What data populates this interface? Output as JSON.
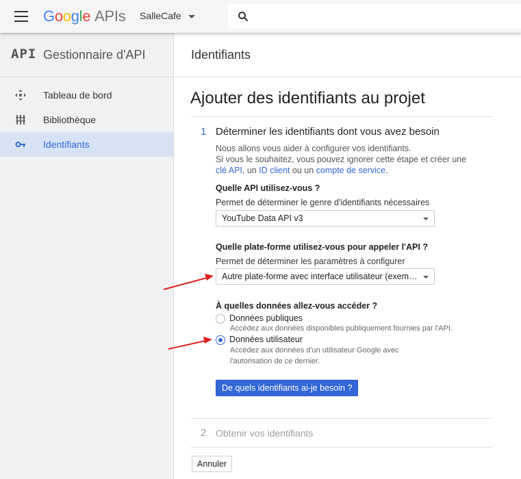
{
  "topbar": {
    "logo_letters": [
      "G",
      "o",
      "o",
      "g",
      "l",
      "e"
    ],
    "logo_suffix": "APIs",
    "project": "SalleCafe",
    "search_value": ""
  },
  "sidebar": {
    "title": "Gestionnaire d'API",
    "api_mark": "API",
    "items": [
      {
        "label": "Tableau de bord",
        "icon": "dashboard-icon"
      },
      {
        "label": "Bibliothèque",
        "icon": "library-icon"
      },
      {
        "label": "Identifiants",
        "icon": "key-icon",
        "active": true
      }
    ]
  },
  "main": {
    "header": "Identifiants",
    "title": "Ajouter des identifiants au projet",
    "step1": {
      "number": "1",
      "title": "Déterminer les identifiants dont vous avez besoin",
      "intro_line1": "Nous allons vous aider à configurer vos identifiants.",
      "intro_line2": "Si vous le souhaitez, vous pouvez ignorer cette étape et créer une",
      "link_api_key": "clé API",
      "sep1": ", un ",
      "link_client_id": "ID client",
      "sep2": " ou un ",
      "link_service_account": "compte de service",
      "end": ".",
      "q1": {
        "label": "Quelle API utilisez-vous ?",
        "hint": "Permet de déterminer le genre d'identifiants nécessaires",
        "value": "YouTube Data API v3"
      },
      "q2": {
        "label": "Quelle plate-forme utilisez-vous pour appeler l'API ?",
        "hint": "Permet de déterminer les paramètres à configurer",
        "value": "Autre plate-forme avec interface utilisateur (exemple..."
      },
      "q3": {
        "label": "À quelles données allez-vous accéder ?",
        "options": [
          {
            "label": "Données publiques",
            "desc": "Accédez aux données disponibles publiquement fournies par l'API.",
            "selected": false
          },
          {
            "label": "Données utilisateur",
            "desc": "Accédez aux données d'un utilisateur Google avec l'autorisation de ce dernier.",
            "selected": true
          }
        ]
      },
      "button": "De quels identifiants ai-je besoin ?"
    },
    "step2": {
      "number": "2",
      "title": "Obtenir vos identifiants"
    },
    "cancel": "Annuler"
  },
  "colors": {
    "accent": "#3367d6",
    "sidebar_bg": "#f1f1f1",
    "annotation_arrow": "#e02020"
  }
}
